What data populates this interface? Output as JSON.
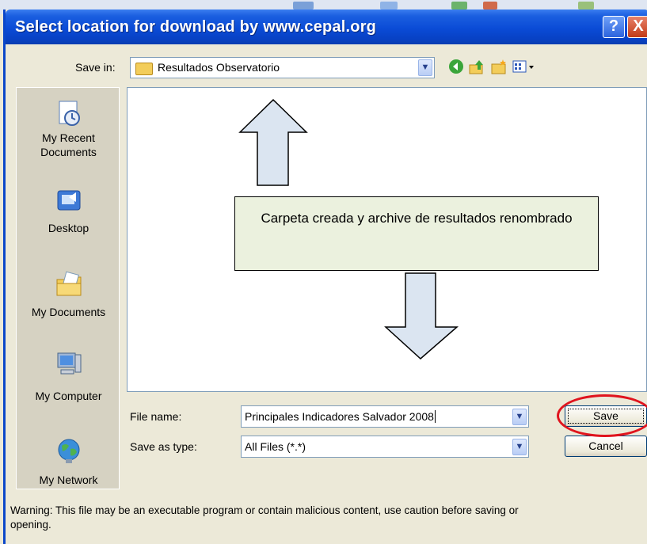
{
  "dialog": {
    "title": "Select location for download by www.cepal.org",
    "help_button": "?",
    "close_button": "X",
    "save_in_label": "Save in:",
    "save_in_value": "Resultados Observatorio",
    "places": [
      {
        "label": "My Recent Documents",
        "icon": "recent-documents-icon"
      },
      {
        "label": "Desktop",
        "icon": "desktop-icon"
      },
      {
        "label": "My Documents",
        "icon": "my-documents-icon"
      },
      {
        "label": "My Computer",
        "icon": "my-computer-icon"
      },
      {
        "label": "My Network",
        "icon": "my-network-icon"
      }
    ],
    "file_name_label": "File name:",
    "file_name_value": "Principales Indicadores Salvador 2008",
    "save_as_type_label": "Save as type:",
    "save_as_type_value": "All Files (*.*)",
    "save_button": "Save",
    "cancel_button": "Cancel",
    "warning": "Warning: This file may be an executable program or contain malicious content, use caution before saving or opening."
  },
  "annotation": {
    "note": "Carpeta creada y archive de resultados renombrado",
    "fill_color": "#ebf1de",
    "arrow_color": "#dbe5f1",
    "highlight_color": "#e0141e"
  }
}
